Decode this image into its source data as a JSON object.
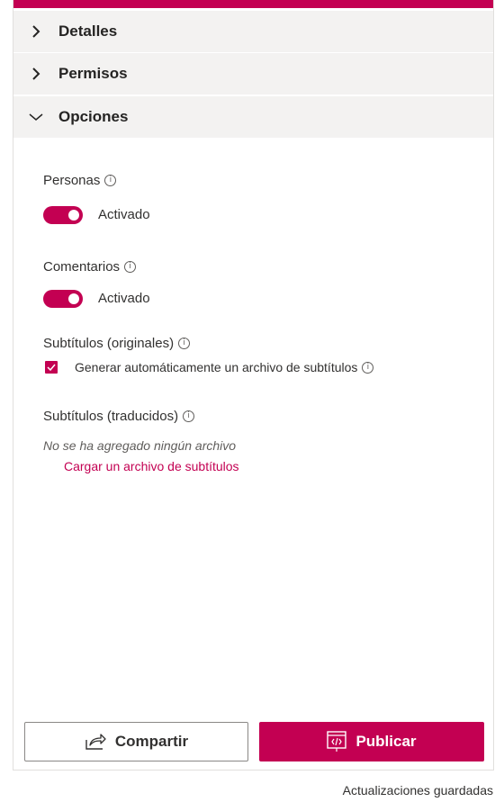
{
  "sections": [
    {
      "label": "Detalles",
      "expanded": false
    },
    {
      "label": "Permisos",
      "expanded": false
    },
    {
      "label": "Opciones",
      "expanded": true
    }
  ],
  "options": {
    "people": {
      "label": "Personas",
      "toggle_state": "Activado",
      "on": true
    },
    "comments": {
      "label": "Comentarios",
      "toggle_state": "Activado",
      "on": true
    },
    "captions_original": {
      "label": "Subtítulos (originales)",
      "checkbox_label": "Generar automáticamente un archivo de subtítulos",
      "checked": true
    },
    "captions_translated": {
      "label": "Subtítulos (traducidos)",
      "empty_text": "No se ha agregado ningún archivo",
      "upload_link": "Cargar un archivo de subtítulos"
    },
    "info_glyph": "i"
  },
  "footer": {
    "share_label": "Compartir",
    "publish_label": "Publicar",
    "status": "Actualizaciones guardadas"
  },
  "colors": {
    "accent": "#c30052",
    "section_bg": "#f3f2f1"
  },
  "icons": {
    "collapsed": "chevron-right-icon",
    "expanded": "chevron-down-icon",
    "info": "info-icon",
    "share": "share-icon",
    "publish": "publish-icon"
  }
}
